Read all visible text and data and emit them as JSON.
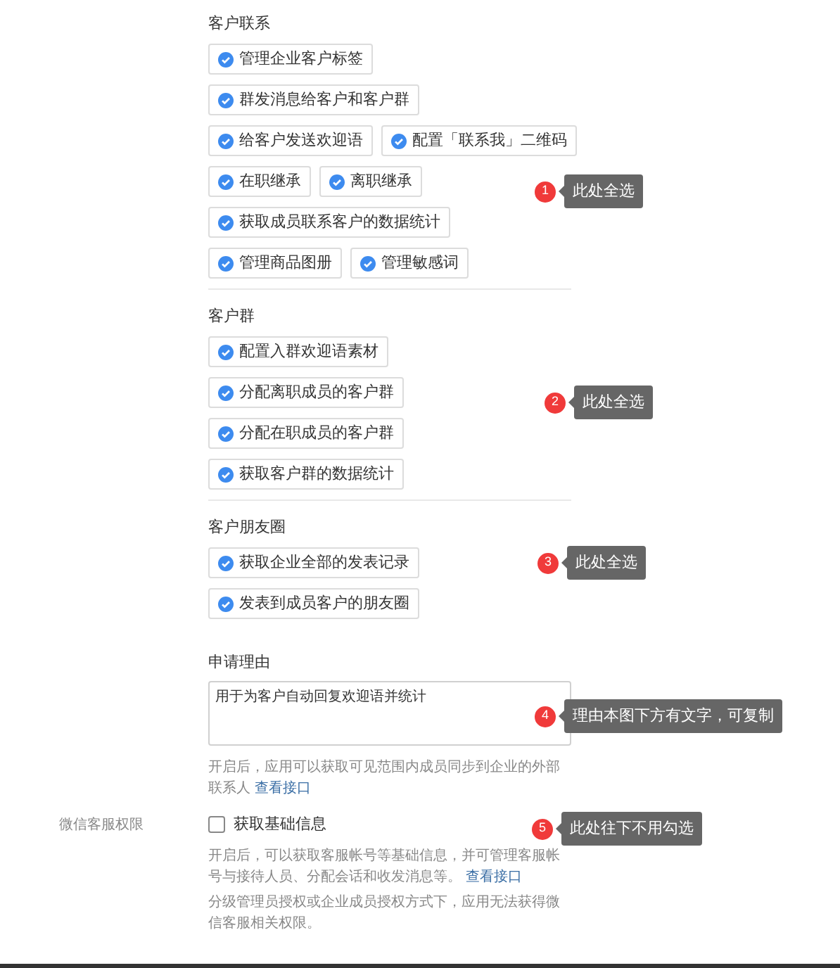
{
  "sections": [
    {
      "title": "客户联系",
      "rows": [
        [
          {
            "label": "管理企业客户标签",
            "checked": true
          }
        ],
        [
          {
            "label": "群发消息给客户和客户群",
            "checked": true
          }
        ],
        [
          {
            "label": "给客户发送欢迎语",
            "checked": true
          },
          {
            "label": "配置「联系我」二维码",
            "checked": true
          }
        ],
        [
          {
            "label": "在职继承",
            "checked": true
          },
          {
            "label": "离职继承",
            "checked": true
          }
        ],
        [
          {
            "label": "获取成员联系客户的数据统计",
            "checked": true
          }
        ],
        [
          {
            "label": "管理商品图册",
            "checked": true
          },
          {
            "label": "管理敏感词",
            "checked": true
          }
        ]
      ]
    },
    {
      "title": "客户群",
      "rows": [
        [
          {
            "label": "配置入群欢迎语素材",
            "checked": true
          }
        ],
        [
          {
            "label": "分配离职成员的客户群",
            "checked": true
          }
        ],
        [
          {
            "label": "分配在职成员的客户群",
            "checked": true
          }
        ],
        [
          {
            "label": "获取客户群的数据统计",
            "checked": true
          }
        ]
      ]
    },
    {
      "title": "客户朋友圈",
      "rows": [
        [
          {
            "label": "获取企业全部的发表记录",
            "checked": true
          }
        ],
        [
          {
            "label": "发表到成员客户的朋友圈",
            "checked": true
          }
        ]
      ]
    }
  ],
  "reason": {
    "title": "申请理由",
    "value": "用于为客户自动回复欢迎语并统计"
  },
  "reason_help": {
    "text": "开启后，应用可以获取可见范围内成员同步到企业的外部联系人",
    "link": "查看接口"
  },
  "wechat_service": {
    "label": "微信客服权限",
    "option": {
      "label": "获取基础信息",
      "checked": false
    },
    "help": {
      "text": "开启后，可以获取客服帐号等基础信息，并可管理客服帐号与接待人员、分配会话和收发消息等。",
      "link": "查看接口"
    },
    "note": "分级管理员授权或企业成员授权方式下，应用无法获得微信客服相关权限。"
  },
  "annotations": [
    {
      "number": "1",
      "text": "此处全选"
    },
    {
      "number": "2",
      "text": "此处全选"
    },
    {
      "number": "3",
      "text": "此处全选"
    },
    {
      "number": "4",
      "text": "理由本图下方有文字，可复制"
    },
    {
      "number": "5",
      "text": "此处往下不用勾选"
    }
  ]
}
